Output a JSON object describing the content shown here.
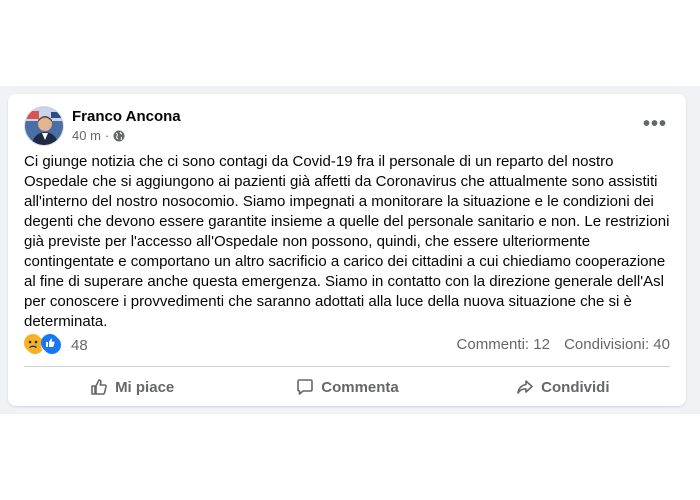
{
  "post": {
    "author": "Franco Ancona",
    "time": "40 m",
    "separator": "·",
    "text": "Ci giunge notizia che ci sono contagi da Covid-19 fra il personale di un reparto del nostro Ospedale che si aggiungono ai pazienti già affetti da Coronavirus che attualmente sono assistiti all'interno del nostro nosocomio. Siamo impegnati a monitorare la situazione e le condizioni dei degenti che devono essere garantite insieme a quelle del personale sanitario e non. Le restrizioni già previste per l'accesso all'Ospedale non possono, quindi, che essere ulteriormente contingentate e comportano un altro sacrificio a carico dei cittadini  a cui chiediamo cooperazione al fine di superare anche questa emergenza. Siamo in contatto con la direzione generale dell'Asl per conoscere i provvedimenti che saranno adottati alla luce della nuova situazione che si è determinata.",
    "reactions": {
      "count": "48",
      "icons": [
        "sad-emoji-icon",
        "like-icon"
      ]
    },
    "comments": "Commenti: 12",
    "shares": "Condivisioni: 40",
    "more_label": "•••"
  },
  "actions": {
    "like": "Mi piace",
    "comment": "Commenta",
    "share": "Condividi"
  },
  "colors": {
    "brand_blue": "#1877f2",
    "secondary_text": "#65676b",
    "feed_bg": "#f0f2f5"
  }
}
